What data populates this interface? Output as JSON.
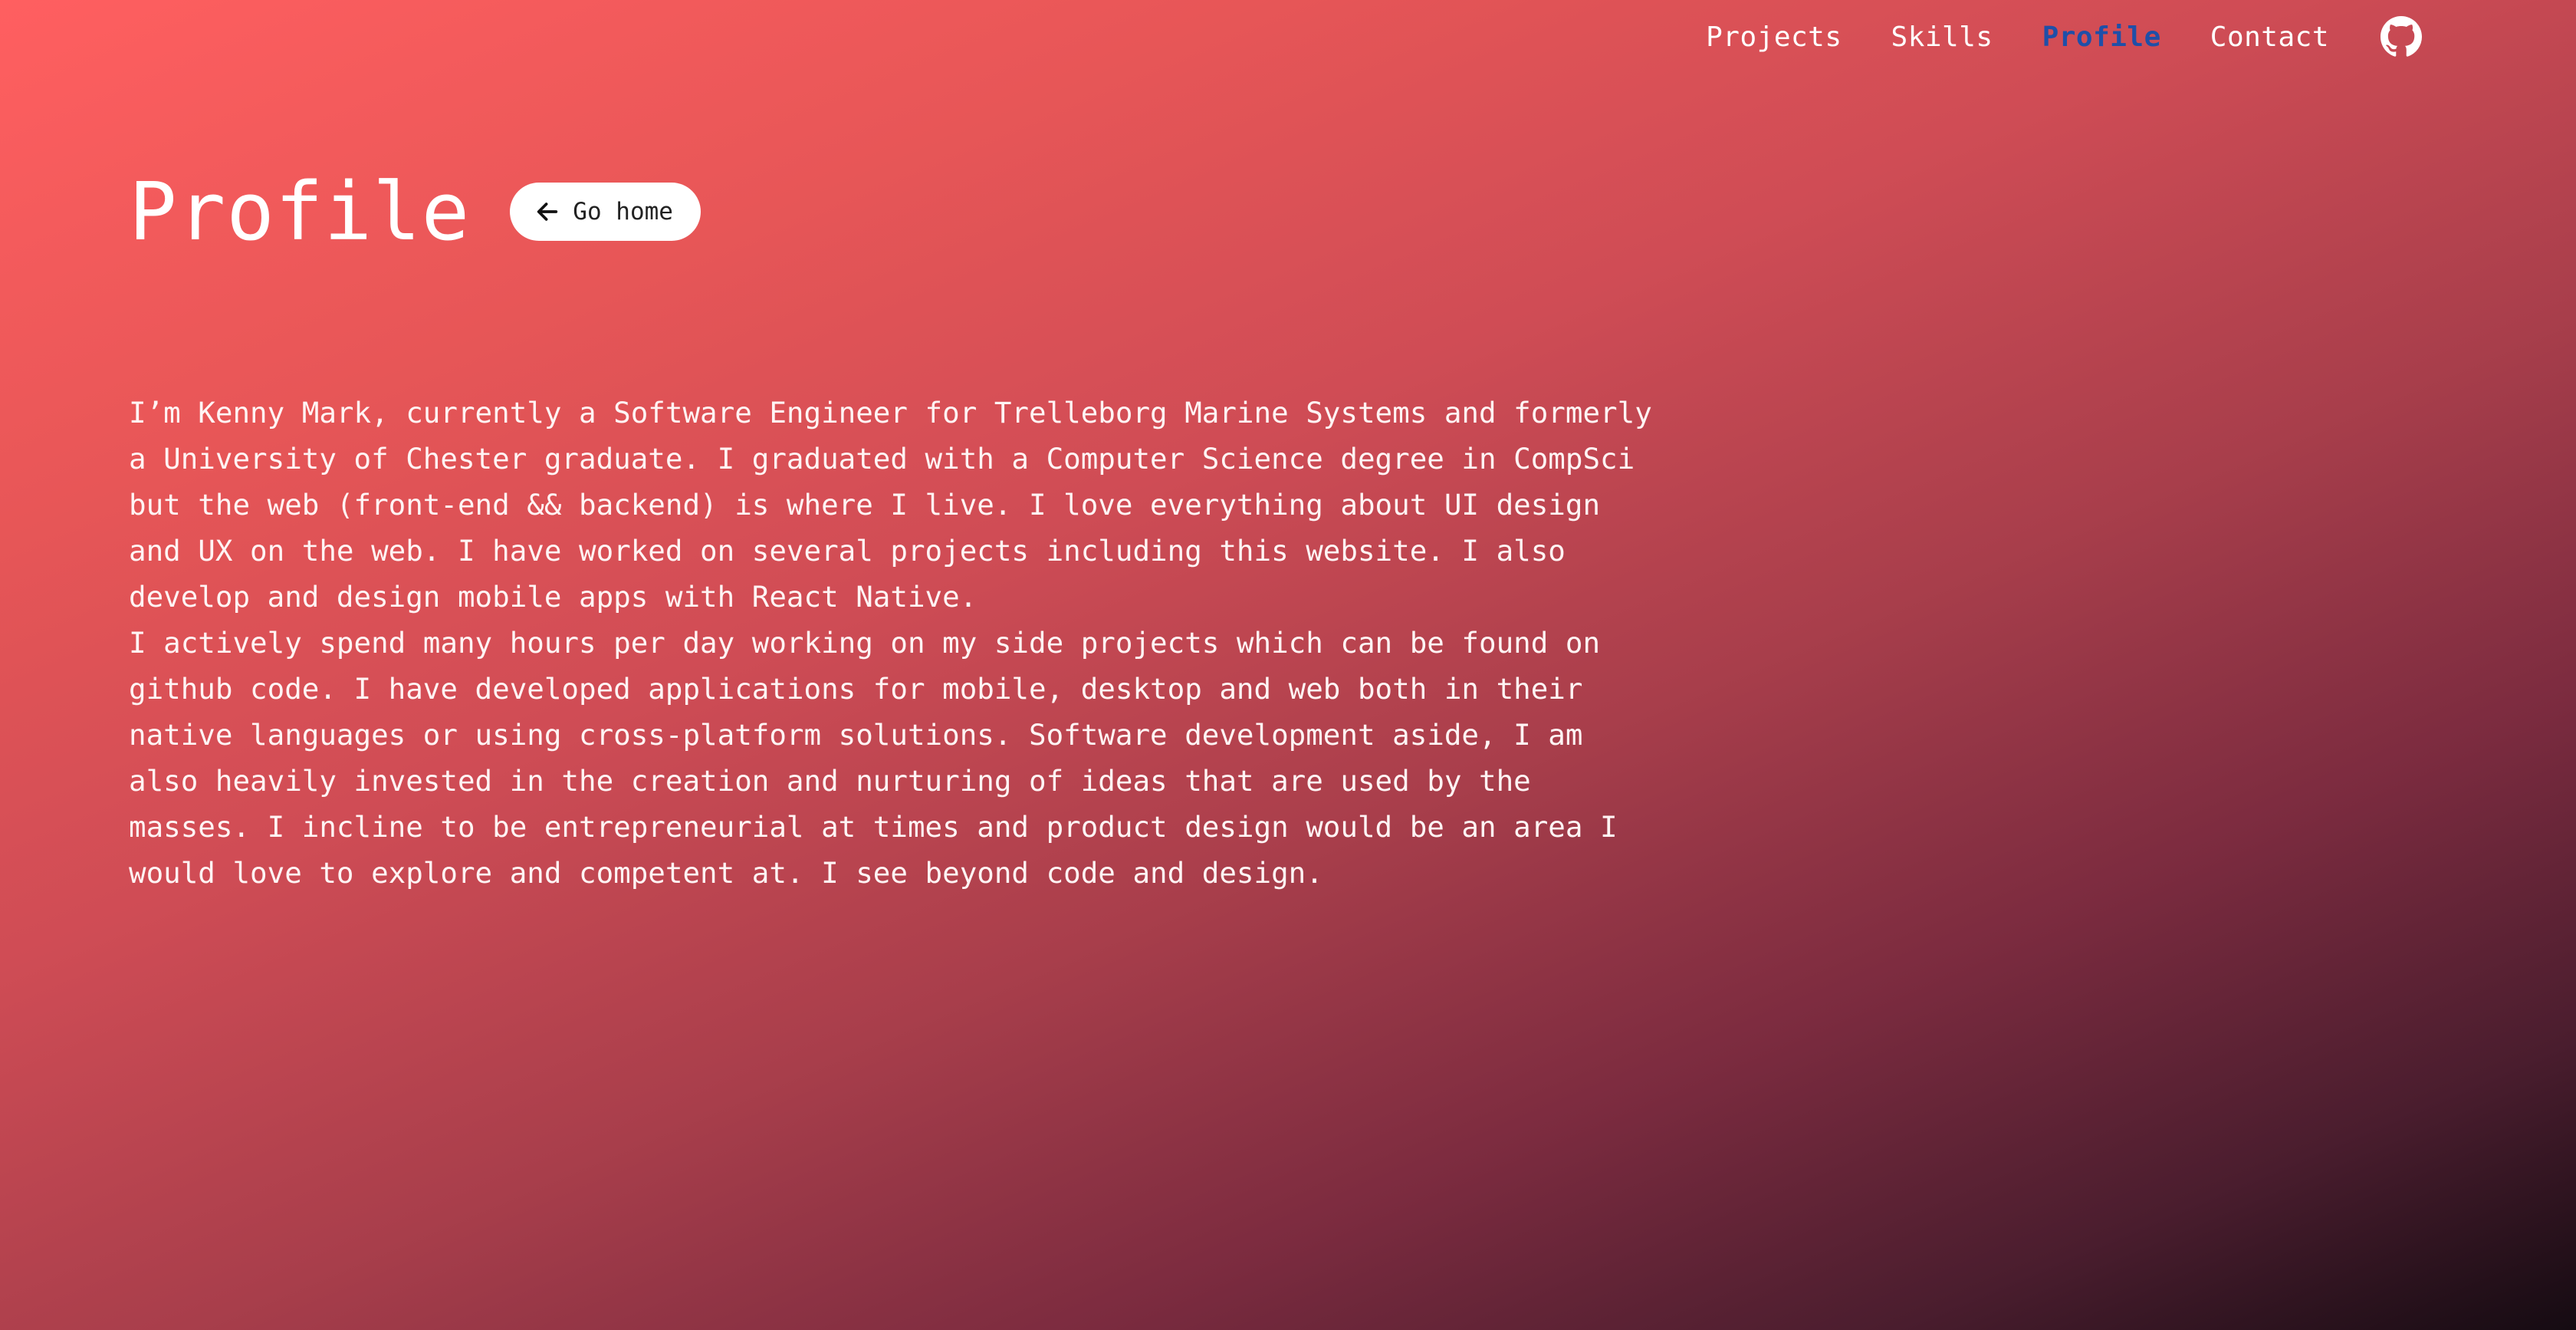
{
  "nav": {
    "items": [
      {
        "label": "Projects"
      },
      {
        "label": "Skills"
      },
      {
        "label": "Profile"
      },
      {
        "label": "Contact"
      }
    ],
    "active_label": "Profile",
    "github_icon": "github-icon",
    "active_color": "#1f4fa8"
  },
  "header": {
    "title": "Profile",
    "go_home_label": "Go home",
    "go_home_icon": "arrow-left-icon"
  },
  "bio": {
    "paragraph_1": "I’m Kenny Mark, currently a Software Engineer for Trelleborg Marine Systems and formerly a University of Chester graduate. I graduated with a Computer Science degree in CompSci but the web (front-end && backend) is where I live. I love everything about UI design and UX on the web. I have worked on several projects including this website. I also develop and design mobile apps with React Native.",
    "paragraph_2": "I actively spend many hours per day working on my side projects which can be found on github code. I have developed applications for mobile, desktop and web both in their native languages or using cross-platform solutions. Software development aside, I am also heavily invested in the creation and nurturing of ideas that are used by the masses. I incline to be entrepreneurial at times and product design would be an area I would love to explore and competent at. I see beyond code and design."
  },
  "theme": {
    "gradient_start": "#ff5f60",
    "gradient_end": "#150b12"
  }
}
